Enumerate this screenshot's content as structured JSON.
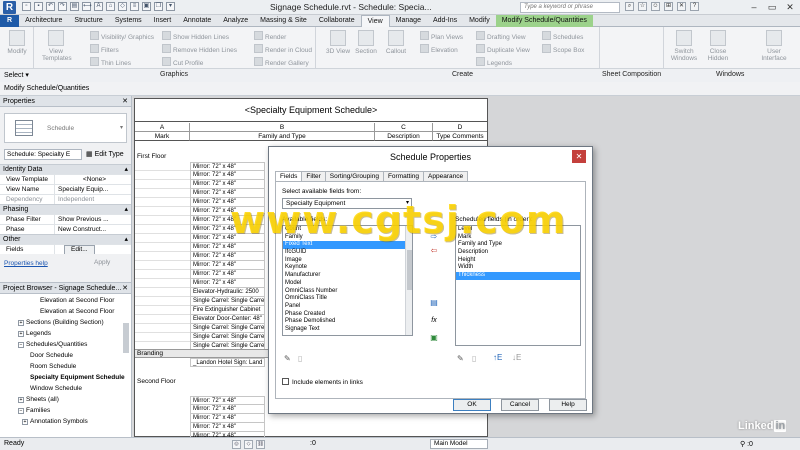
{
  "window": {
    "title": "Signage Schedule.rvt - Schedule: Specia...",
    "search_placeholder": "Type a keyword or phrase",
    "app_letter": "R"
  },
  "tabs": [
    "Architecture",
    "Structure",
    "Systems",
    "Insert",
    "Annotate",
    "Analyze",
    "Massing & Site",
    "Collaborate",
    "View",
    "Manage",
    "Add-Ins",
    "Modify",
    "Modify Schedule/Quantities"
  ],
  "active_tab": "View",
  "ribbon": {
    "modify": "Modify",
    "view_templates": "View Templates",
    "visibility_graphics": "Visibility/ Graphics",
    "filters": "Filters",
    "thin_lines": "Thin Lines",
    "show_hidden_lines": "Show Hidden Lines",
    "remove_hidden_lines": "Remove Hidden Lines",
    "cut_profile": "Cut Profile",
    "render": "Render",
    "render_in_cloud": "Render in Cloud",
    "render_gallery": "Render Gallery",
    "view_3d": "3D View",
    "section": "Section",
    "callout": "Callout",
    "plan_views": "Plan Views",
    "elevation": "Elevation",
    "drafting_view": "Drafting View",
    "duplicate_view": "Duplicate View",
    "legends": "Legends",
    "schedules": "Schedules",
    "scope_box": "Scope Box",
    "switch_windows": "Switch Windows",
    "close_hidden": "Close Hidden",
    "user_interface": "User Interface",
    "group_select": "Select",
    "group_graphics": "Graphics",
    "group_create": "Create",
    "group_sheet": "Sheet Composition",
    "group_windows": "Windows"
  },
  "context_label": "Modify Schedule/Quantities",
  "properties": {
    "header": "Properties",
    "type_name": "Schedule",
    "instance_select": "Schedule: Specialty E",
    "edit_type": "Edit Type",
    "identity_section": "Identity Data",
    "rows_identity": [
      {
        "k": "View Template",
        "v": "<None>"
      },
      {
        "k": "View Name",
        "v": "Specialty Equip..."
      },
      {
        "k": "Dependency",
        "v": "Independent"
      }
    ],
    "phasing_section": "Phasing",
    "rows_phasing": [
      {
        "k": "Phase Filter",
        "v": "Show Previous ..."
      },
      {
        "k": "Phase",
        "v": "New Construct..."
      }
    ],
    "other_section": "Other",
    "fields_label": "Fields",
    "edit_button": "Edit...",
    "help_link": "Properties help",
    "apply": "Apply"
  },
  "browser": {
    "header": "Project Browser - Signage Schedule...",
    "items": [
      "Elevation at Second Floor",
      "Elevation at Second Floor",
      "Sections (Building Section)",
      "Legends",
      "Schedules/Quantities",
      "Door Schedule",
      "Room Schedule",
      "Specialty Equipment Schedule",
      "Window Schedule",
      "Sheets (all)",
      "Families",
      "Annotation Symbols"
    ]
  },
  "schedule": {
    "title": "<Specialty Equipment Schedule>",
    "col_letters": [
      "A",
      "B",
      "C",
      "D"
    ],
    "col_fields": [
      "Mark",
      "Family and Type",
      "Description",
      "Type Comments"
    ],
    "group_first": "First Floor",
    "group_branding": "Branding",
    "group_second": "Second Floor",
    "rows_first": [
      "Mirror: 72\" x 48\"",
      "Mirror: 72\" x 48\"",
      "Mirror: 72\" x 48\"",
      "Mirror: 72\" x 48\"",
      "Mirror: 72\" x 48\"",
      "Mirror: 72\" x 48\"",
      "Mirror: 72\" x 48\"",
      "Mirror: 72\" x 48\"",
      "Mirror: 72\" x 48\"",
      "Mirror: 72\" x 48\"",
      "Mirror: 72\" x 48\"",
      "Mirror: 72\" x 48\"",
      "Mirror: 72\" x 48\"",
      "Mirror: 72\" x 48\"",
      "Elevator-Hydraulic: 2500",
      "Single Carrel: Single Carre",
      "Fire Extinguisher Cabinet",
      "Elevator Door-Center: 48\"",
      "Single Carrel: Single Carre",
      "Single Carrel: Single Carre",
      "Single Carrel: Single Carre"
    ],
    "row_branding": "_Landon Hotel Sign: Land",
    "rows_second": [
      "Mirror: 72\" x 48\"",
      "Mirror: 72\" x 48\"",
      "Mirror: 72\" x 48\"",
      "Mirror: 72\" x 48\"",
      "Mirror: 72\" x 48\"",
      "Mirror: 72\" x 48\"",
      "Mirror: 72\" x 48\"",
      "Mirror: 72\" x 48\""
    ]
  },
  "dialog": {
    "title": "Schedule Properties",
    "close": "✕",
    "tabs": [
      "Fields",
      "Filter",
      "Sorting/Grouping",
      "Formatting",
      "Appearance"
    ],
    "active_tab": "Fields",
    "select_label": "Select available fields from:",
    "select_value": "Specialty Equipment",
    "available_label": "Available fields:",
    "scheduled_label": "Scheduled fields (in order):",
    "available": [
      "Count",
      "Family",
      "Fixed Text",
      "IfcGUID",
      "Image",
      "Keynote",
      "Manufacturer",
      "Model",
      "OmniClass Number",
      "OmniClass Title",
      "Panel",
      "Phase Created",
      "Phase Demolished",
      "Signage Text"
    ],
    "available_selected": "Fixed Text",
    "scheduled": [
      "Level",
      "Mark",
      "Family and Type",
      "Description",
      "Height",
      "Width",
      "Thickness"
    ],
    "scheduled_selected": "Thickness",
    "include_links": "Include elements in links",
    "ok": "OK",
    "cancel": "Cancel",
    "help": "Help"
  },
  "watermark": "www.cgtsj.com",
  "status": {
    "ready": "Ready",
    "zero": ":0",
    "model": "Main Model"
  },
  "brand": {
    "linked": "Linked",
    "in": "in"
  },
  "colors": {
    "file_tab": "#1e5aa8",
    "context_tab": "#9cd28b",
    "selection": "#3399ff",
    "close_btn": "#c4403c",
    "watermark": "#ffd600"
  }
}
